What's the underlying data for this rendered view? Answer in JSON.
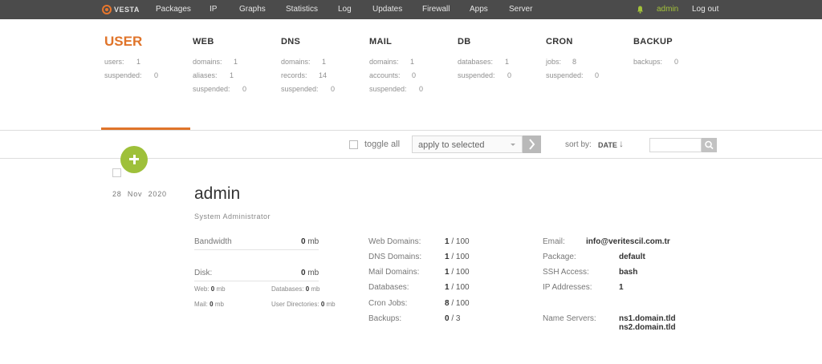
{
  "nav": {
    "logo_text": "VESTA",
    "items": [
      "Packages",
      "IP",
      "Graphs",
      "Statistics",
      "Log",
      "Updates",
      "Firewall",
      "Apps",
      "Server"
    ],
    "user": "admin",
    "logout": "Log out"
  },
  "stats": {
    "user": {
      "title": "USER",
      "rows": [
        {
          "label": "users:",
          "value": "1"
        },
        {
          "label": "suspended:",
          "value": "0"
        }
      ]
    },
    "web": {
      "title": "WEB",
      "rows": [
        {
          "label": "domains:",
          "value": "1"
        },
        {
          "label": "aliases:",
          "value": "1"
        },
        {
          "label": "suspended:",
          "value": "0"
        }
      ]
    },
    "dns": {
      "title": "DNS",
      "rows": [
        {
          "label": "domains:",
          "value": "1"
        },
        {
          "label": "records:",
          "value": "14"
        },
        {
          "label": "suspended:",
          "value": "0"
        }
      ]
    },
    "mail": {
      "title": "MAIL",
      "rows": [
        {
          "label": "domains:",
          "value": "1"
        },
        {
          "label": "accounts:",
          "value": "0"
        },
        {
          "label": "suspended:",
          "value": "0"
        }
      ]
    },
    "db": {
      "title": "DB",
      "rows": [
        {
          "label": "databases:",
          "value": "1"
        },
        {
          "label": "suspended:",
          "value": "0"
        }
      ]
    },
    "cron": {
      "title": "CRON",
      "rows": [
        {
          "label": "jobs:",
          "value": "8"
        },
        {
          "label": "suspended:",
          "value": "0"
        }
      ]
    },
    "backup": {
      "title": "BACKUP",
      "rows": [
        {
          "label": "backups:",
          "value": "0"
        }
      ]
    }
  },
  "toolbar": {
    "toggle_all": "toggle all",
    "apply_select": "apply to selected",
    "sort_label": "sort by:",
    "sort_value": "DATE",
    "sort_arrow": "↓"
  },
  "user_row": {
    "date": "28 Nov 2020",
    "name": "admin",
    "role": "System Administrator",
    "bandwidth": {
      "label": "Bandwidth",
      "value": "0",
      "unit": "mb"
    },
    "disk": {
      "label": "Disk:",
      "value": "0",
      "unit": "mb"
    },
    "disk_breakdown": [
      {
        "label": "Web:",
        "value": "0",
        "unit": "mb"
      },
      {
        "label": "Databases:",
        "value": "0",
        "unit": "mb"
      },
      {
        "label": "Mail:",
        "value": "0",
        "unit": "mb"
      },
      {
        "label": "User Directories:",
        "value": "0",
        "unit": "mb"
      }
    ],
    "limits": [
      {
        "label": "Web Domains:",
        "used": "1",
        "max": "100"
      },
      {
        "label": "DNS Domains:",
        "used": "1",
        "max": "100"
      },
      {
        "label": "Mail Domains:",
        "used": "1",
        "max": "100"
      },
      {
        "label": "Databases:",
        "used": "1",
        "max": "100"
      },
      {
        "label": "Cron Jobs:",
        "used": "8",
        "max": "100"
      },
      {
        "label": "Backups:",
        "used": "0",
        "max": "3"
      }
    ],
    "details": [
      {
        "label": "Email:",
        "value": "info@veritescil.com.tr"
      },
      {
        "label": "Package:",
        "value": "default"
      },
      {
        "label": "SSH Access:",
        "value": "bash"
      },
      {
        "label": "IP Addresses:",
        "value": "1"
      }
    ],
    "name_servers": {
      "label": "Name Servers:",
      "values": [
        "ns1.domain.tld",
        "ns2.domain.tld"
      ]
    }
  },
  "colors": {
    "accent": "#e0742a",
    "add_button": "#9ec03a",
    "nav_bg": "#4b4b4b"
  }
}
